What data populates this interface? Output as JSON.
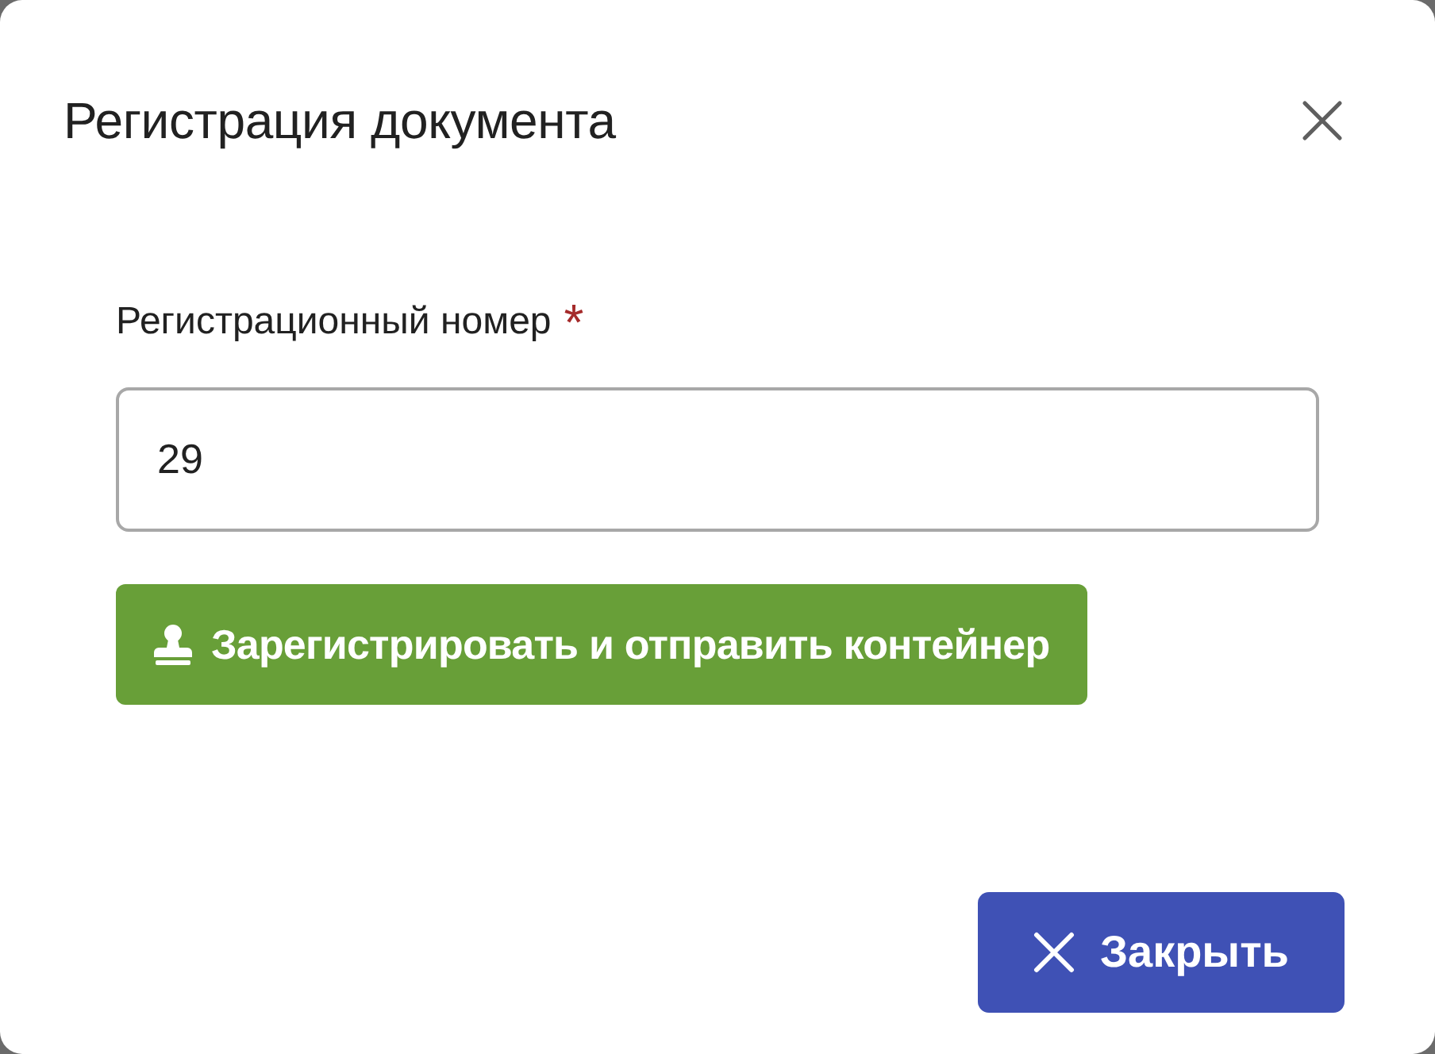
{
  "dialog": {
    "title": "Регистрация документа"
  },
  "field": {
    "label": "Регистрационный номер",
    "required_mark": "*",
    "value": "29"
  },
  "actions": [
    {
      "kind": "register",
      "label": "Зарегистрировать и отправить контейнер"
    }
  ],
  "footer": {
    "close_label": "Закрыть"
  }
}
